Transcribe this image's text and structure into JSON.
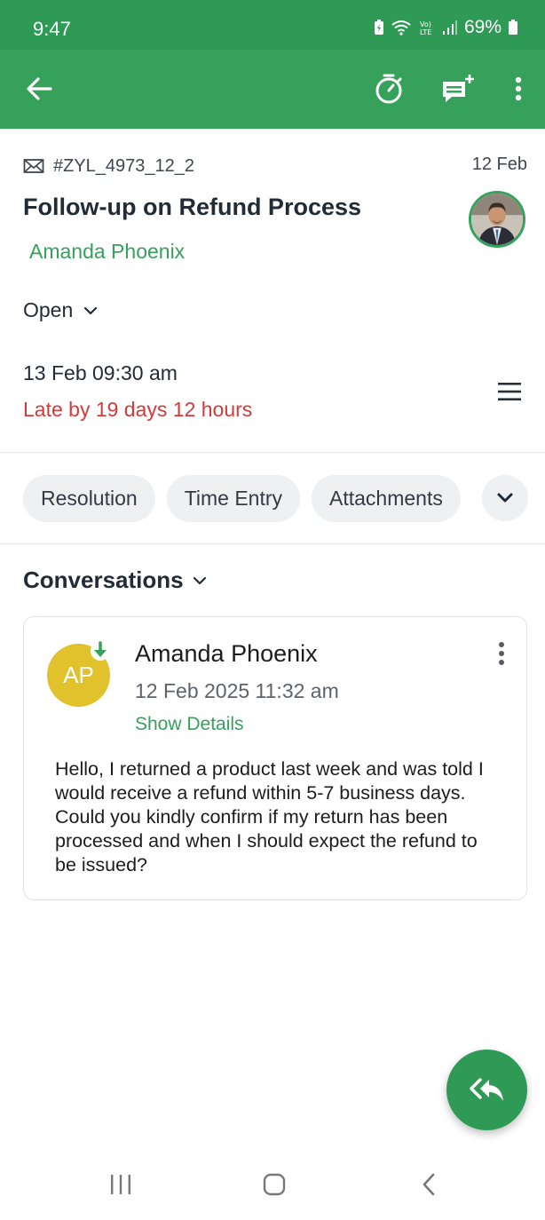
{
  "status_bar": {
    "time": "9:47",
    "battery": "69%"
  },
  "ticket": {
    "id": "#ZYL_4973_12_2",
    "date": "12 Feb",
    "subject": "Follow-up on Refund Process",
    "contact": "Amanda Phoenix",
    "status": "Open",
    "due_date": "13 Feb 09:30 am",
    "overdue": "Late by 19 days 12 hours"
  },
  "tabs": [
    {
      "label": "Resolution"
    },
    {
      "label": "Time Entry"
    },
    {
      "label": "Attachments"
    }
  ],
  "conversations": {
    "heading": "Conversations",
    "items": [
      {
        "initials": "AP",
        "sender": "Amanda Phoenix",
        "time": "12 Feb 2025 11:32 am",
        "details_link": "Show Details",
        "body": "Hello, I returned a product last week and was told I would receive a refund within 5-7 business days. Could you kindly confirm if my return has been processed and when I should expect the refund to be issued?"
      }
    ]
  },
  "colors": {
    "primary": "#36a15a",
    "status_bar": "#2e9a55",
    "overdue": "#d6393a",
    "avatar": "#e1c22c"
  },
  "icons": {
    "app_bar": [
      "back-arrow-icon",
      "timer-icon",
      "add-comment-icon",
      "more-vertical-icon"
    ],
    "nav": [
      "recent-apps-icon",
      "home-icon",
      "back-icon"
    ]
  }
}
